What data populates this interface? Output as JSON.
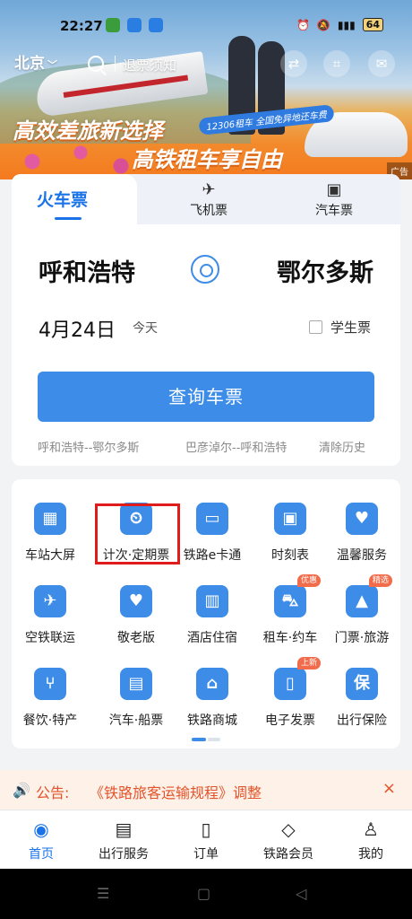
{
  "status_bar": {
    "time": "22:27",
    "battery": "64"
  },
  "header": {
    "city": "北京",
    "search_text": "退票须知"
  },
  "banner": {
    "slogan_1": "高效差旅新选择",
    "slogan_2": "高铁租车享自由",
    "promo": "12306租车 全国免异地还车费",
    "ad_tag": "广告"
  },
  "ticket": {
    "tabs": [
      "火车票",
      "飞机票",
      "汽车票"
    ],
    "from": "呼和浩特",
    "to": "鄂尔多斯",
    "date": "4月24日",
    "today": "今天",
    "student_label": "学生票",
    "query_button": "查询车票",
    "history": [
      "呼和浩特--鄂尔多斯",
      "巴彦淖尔--呼和浩特"
    ],
    "clear_history": "清除历史"
  },
  "services": [
    {
      "label": "车站大屏",
      "icon": "calendar-icon",
      "glyph": "▦"
    },
    {
      "label": "计次·定期票",
      "icon": "pass-card-icon",
      "glyph": "⏲"
    },
    {
      "label": "铁路e卡通",
      "icon": "ecard-icon",
      "glyph": "▭"
    },
    {
      "label": "时刻表",
      "icon": "train-front-icon",
      "glyph": "▣"
    },
    {
      "label": "温馨服务",
      "icon": "heart-book-icon",
      "glyph": "♥"
    },
    {
      "label": "空铁联运",
      "icon": "plane-train-icon",
      "glyph": "✈"
    },
    {
      "label": "敬老版",
      "icon": "heart-icon",
      "glyph": "♥"
    },
    {
      "label": "酒店住宿",
      "icon": "building-icon",
      "glyph": "▥"
    },
    {
      "label": "租车·约车",
      "icon": "car-icon",
      "glyph": "⛍",
      "badge": "优惠"
    },
    {
      "label": "门票·旅游",
      "icon": "mountain-icon",
      "glyph": "▲",
      "badge": "精选"
    },
    {
      "label": "餐饮·特产",
      "icon": "cutlery-icon",
      "glyph": "⑂"
    },
    {
      "label": "汽车·船票",
      "icon": "bus-icon",
      "glyph": "▤"
    },
    {
      "label": "铁路商城",
      "icon": "shop-icon",
      "glyph": "⌂"
    },
    {
      "label": "电子发票",
      "icon": "invoice-icon",
      "glyph": "▯",
      "badge": "上新"
    },
    {
      "label": "出行保险",
      "icon": "shield-icon",
      "glyph": "保"
    }
  ],
  "notice": {
    "label": "公告:",
    "text": "《铁路旅客运输规程》调整"
  },
  "bottom_nav": [
    "首页",
    "出行服务",
    "订单",
    "铁路会员",
    "我的"
  ],
  "colors": {
    "accent": "#1a73e8",
    "button": "#3c8ce8",
    "notice": "#e4532a",
    "highlight": "#e01b1b"
  }
}
